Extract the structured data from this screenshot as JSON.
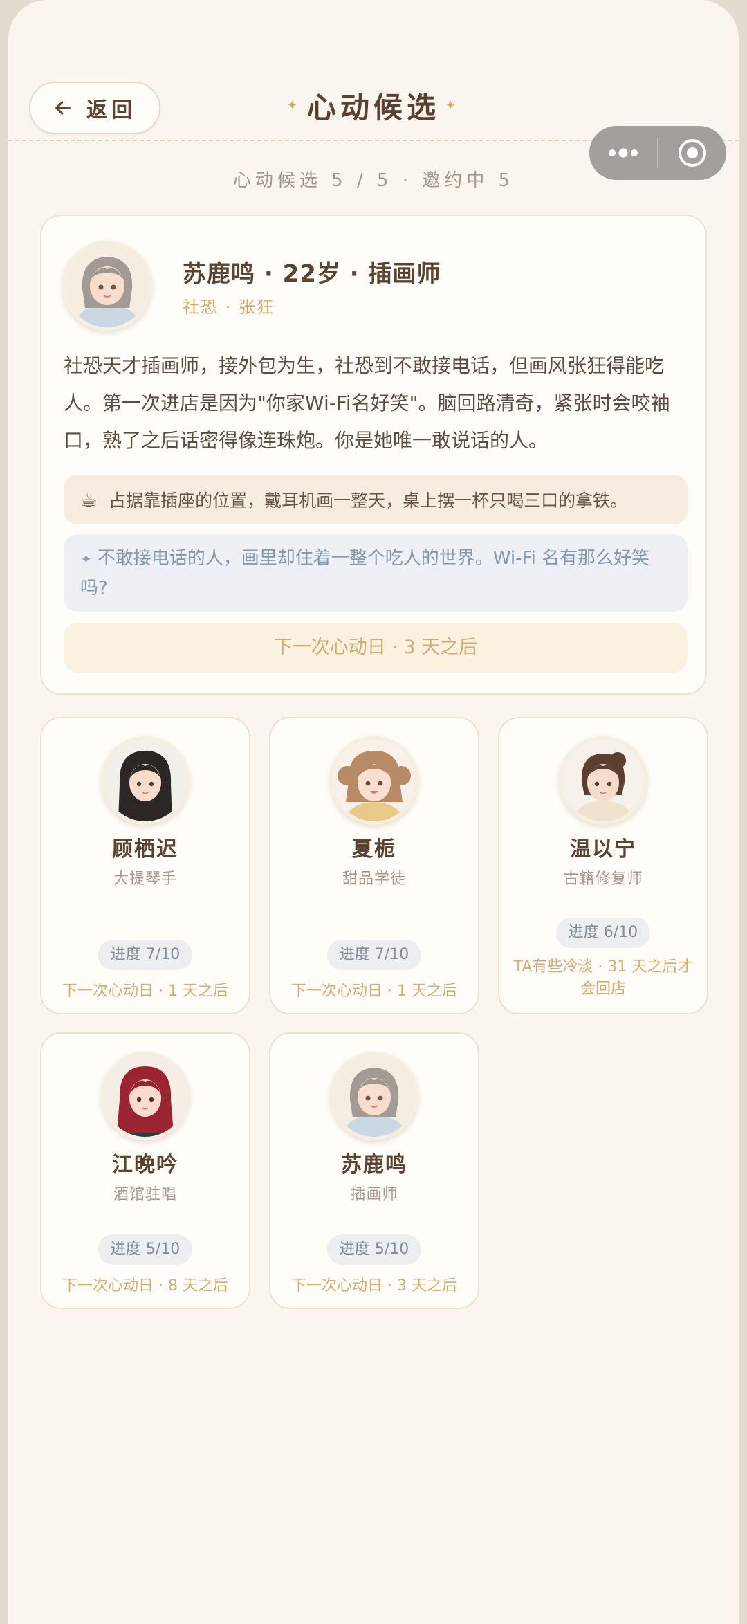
{
  "header": {
    "back_label": "返回",
    "title": "心动候选",
    "stats": "心动候选 5 / 5 · 邀约中 5"
  },
  "featured": {
    "name": "苏鹿鸣 · 22岁 · 插画师",
    "tags": "社恐 · 张狂",
    "bio": "社恐天才插画师，接外包为生，社恐到不敢接电话，但画风张狂得能吃人。第一次进店是因为\"你家Wi-Fi名好笑\"。脑回路清奇，紧张时会咬袖口，熟了之后话密得像连珠炮。你是她唯一敢说话的人。",
    "habit": "占据靠插座的位置，戴耳机画一整天，桌上摆一杯只喝三口的拿铁。",
    "quote": "不敢接电话的人，画里却住着一整个吃人的世界。Wi-Fi 名有那么好笑吗?",
    "next_date": "下一次心动日 · 3 天之后"
  },
  "cards": [
    {
      "name": "顾栖迟",
      "role": "大提琴手",
      "progress": "进度 7/10",
      "next": "下一次心动日 · 1 天之后"
    },
    {
      "name": "夏栀",
      "role": "甜品学徒",
      "progress": "进度 7/10",
      "next": "下一次心动日 · 1 天之后"
    },
    {
      "name": "温以宁",
      "role": "古籍修复师",
      "progress": "进度 6/10",
      "next": "TA有些冷淡 · 31 天之后才会回店"
    },
    {
      "name": "江晚吟",
      "role": "酒馆驻唱",
      "progress": "进度 5/10",
      "next": "下一次心动日 · 8 天之后"
    },
    {
      "name": "苏鹿鸣",
      "role": "插画师",
      "progress": "进度 5/10",
      "next": "下一次心动日 · 3 天之后"
    }
  ],
  "icons": {
    "back": "arrow-left-icon",
    "more": "more-dots-icon",
    "close": "target-circle-icon",
    "habit": "coffee-cup-icon",
    "quote": "sparkle-icon"
  },
  "colors": {
    "background": "#faf6ef",
    "title": "#5a4232",
    "accent_gold": "#d0aa6f",
    "quote_bg": "#edf1f5",
    "habit_bg": "#f6ece0"
  }
}
